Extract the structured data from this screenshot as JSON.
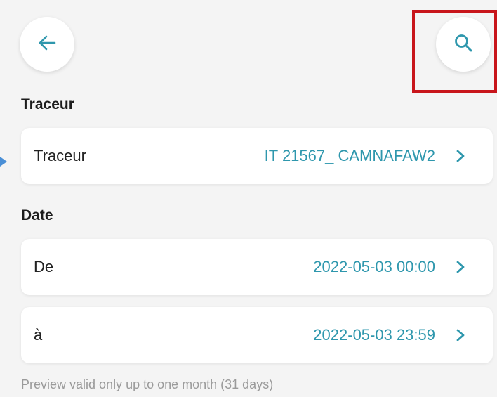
{
  "header": {
    "back_icon": "arrow-left-icon",
    "search_icon": "search-icon"
  },
  "tracker_section": {
    "title": "Traceur",
    "row_label": "Traceur",
    "row_value": "IT 21567_ CAMNAFAW2"
  },
  "date_section": {
    "title": "Date",
    "from_label": "De",
    "from_value": "2022-05-03 00:00",
    "to_label": "à",
    "to_value": "2022-05-03 23:59"
  },
  "hint": "Preview valid only up to one month (31 days)",
  "colors": {
    "accent": "#2e97ad",
    "highlight": "#c8151b",
    "background": "#f4f4f4"
  }
}
